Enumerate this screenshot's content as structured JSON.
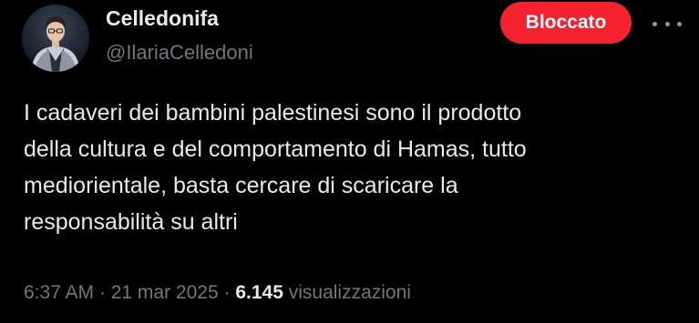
{
  "author": {
    "display_name": "Celledonifa",
    "handle": "@IlariaCelledoni"
  },
  "header": {
    "blocked_label": "Bloccato",
    "more_icon": "more-horizontal-icon",
    "blocked_color": "#f4212e"
  },
  "tweet": {
    "text": "I cadaveri dei bambini palestinesi sono il prodotto\ndella cultura e del comportamento di Hamas, tutto\nmediorientale, basta cercare di scaricare la\nresponsabilità su altri"
  },
  "meta": {
    "time": "6:37 AM",
    "sep1": " · ",
    "date": "21 mar 2025",
    "sep2": " · ",
    "views_count": "6.145",
    "views_label": " visualizzazioni"
  }
}
